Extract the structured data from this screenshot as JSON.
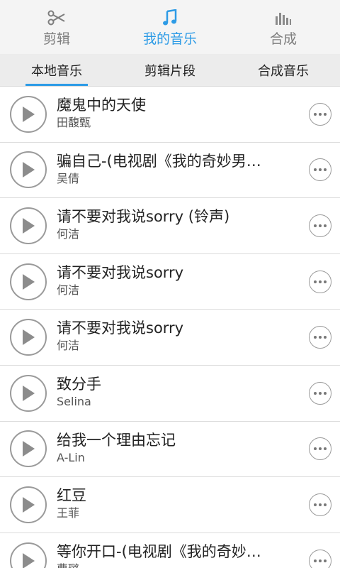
{
  "top_tabs": [
    {
      "label": "剪辑",
      "icon": "scissors-icon",
      "active": false
    },
    {
      "label": "我的音乐",
      "icon": "music-note-icon",
      "active": true
    },
    {
      "label": "合成",
      "icon": "equalizer-icon",
      "active": false
    }
  ],
  "sub_tabs": [
    {
      "label": "本地音乐",
      "active": true
    },
    {
      "label": "剪辑片段",
      "active": false
    },
    {
      "label": "合成音乐",
      "active": false
    }
  ],
  "songs": [
    {
      "title": "魔鬼中的天使",
      "artist": "田馥甄"
    },
    {
      "title": "骗自己-(电视剧《我的奇妙男…",
      "artist": "吴倩"
    },
    {
      "title": "请不要对我说sorry (铃声)",
      "artist": "何洁"
    },
    {
      "title": "请不要对我说sorry",
      "artist": "何洁"
    },
    {
      "title": "请不要对我说sorry",
      "artist": "何洁"
    },
    {
      "title": "致分手",
      "artist": "Selina"
    },
    {
      "title": "给我一个理由忘记",
      "artist": "A-Lin"
    },
    {
      "title": "红豆",
      "artist": "王菲"
    },
    {
      "title": "等你开口-(电视剧《我的奇妙…",
      "artist": "曹璐"
    }
  ],
  "colors": {
    "accent": "#2d9be6",
    "inactive": "#7d7d7d"
  }
}
